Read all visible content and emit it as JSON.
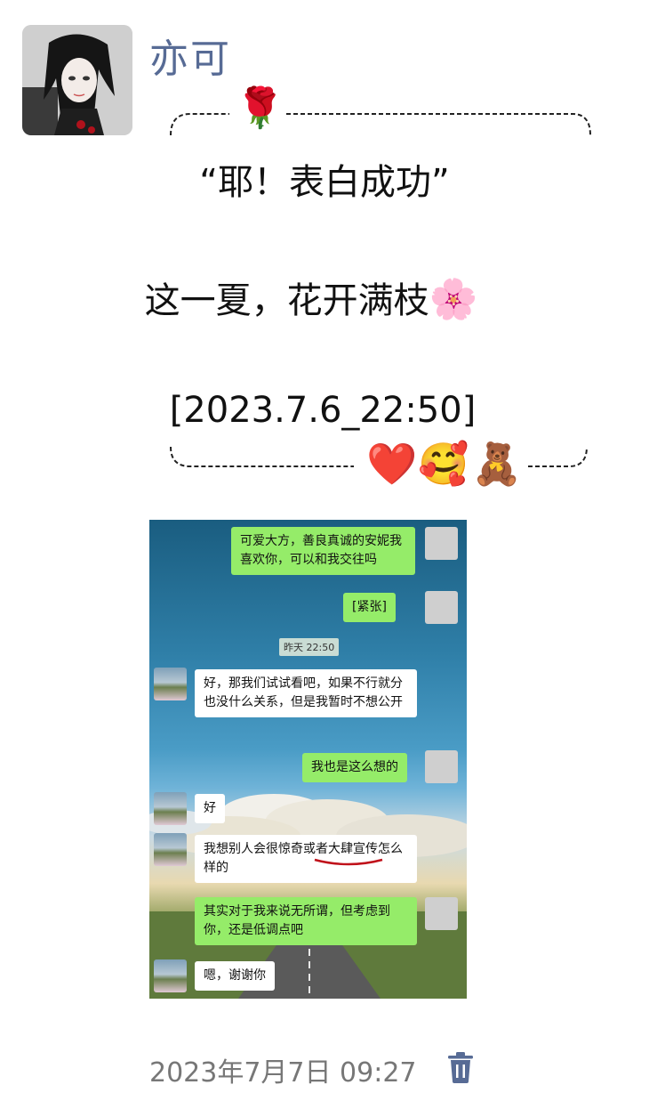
{
  "post": {
    "author": "亦可",
    "line1": "“耶！表白成功”",
    "line2": "这一夏，花开满枝",
    "line3": "[2023.7.6_22:50]",
    "emojis": {
      "top": "🌹",
      "line2_end": "🌸",
      "bottom": [
        "❤️",
        "🥰",
        "🧸"
      ]
    },
    "timestamp": "2023年7月7日 09:27"
  },
  "chat_screenshot": {
    "time_label": "昨天 22:50",
    "messages": [
      {
        "sender": "me",
        "text": "可爱大方，善良真诚的安妮我喜欢你，可以和我交往吗"
      },
      {
        "sender": "me",
        "text": "[紧张]"
      },
      {
        "sender": "them",
        "text": "好，那我们试试看吧，如果不行就分也没什么关系，但是我暂时不想公开"
      },
      {
        "sender": "me",
        "text": "我也是这么想的"
      },
      {
        "sender": "them",
        "text": "好"
      },
      {
        "sender": "them",
        "text": "我想别人会很惊奇或者大肆宣传怎么样的"
      },
      {
        "sender": "me",
        "text": "其实对于我来说无所谓，但考虑到你，还是低调点吧"
      },
      {
        "sender": "them",
        "text": "嗯，谢谢你"
      }
    ]
  },
  "icons": {
    "delete": "trash-icon"
  },
  "colors": {
    "author_name": "#576b95",
    "my_bubble": "#95ec69",
    "their_bubble": "#ffffff",
    "trash": "#576b95",
    "timestamp": "#777777"
  }
}
